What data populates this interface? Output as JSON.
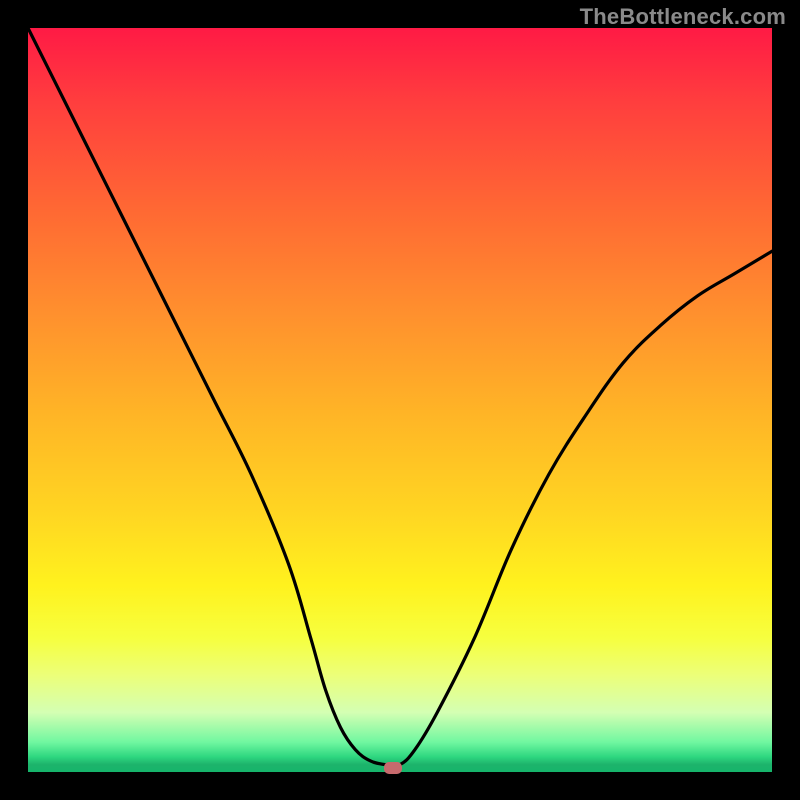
{
  "watermark": "TheBottleneck.com",
  "colors": {
    "curve_stroke": "#000000",
    "marker_fill": "#c76a6d",
    "frame": "#000000"
  },
  "chart_data": {
    "type": "line",
    "title": "",
    "xlabel": "",
    "ylabel": "",
    "xlim": [
      0,
      1
    ],
    "ylim": [
      0,
      1
    ],
    "grid": false,
    "legend": false,
    "series": [
      {
        "name": "bottleneck-curve",
        "x": [
          0.0,
          0.05,
          0.1,
          0.15,
          0.2,
          0.25,
          0.3,
          0.35,
          0.38,
          0.4,
          0.42,
          0.44,
          0.46,
          0.48,
          0.5,
          0.52,
          0.55,
          0.6,
          0.65,
          0.7,
          0.75,
          0.8,
          0.85,
          0.9,
          0.95,
          1.0
        ],
        "y": [
          1.0,
          0.9,
          0.8,
          0.7,
          0.6,
          0.5,
          0.4,
          0.28,
          0.18,
          0.11,
          0.06,
          0.03,
          0.015,
          0.01,
          0.01,
          0.03,
          0.08,
          0.18,
          0.3,
          0.4,
          0.48,
          0.55,
          0.6,
          0.64,
          0.67,
          0.7
        ]
      }
    ],
    "marker": {
      "x": 0.49,
      "y": 0.005
    },
    "background_gradient": {
      "type": "vertical",
      "stops": [
        {
          "pos": 0.0,
          "color": "#ff1a45"
        },
        {
          "pos": 0.25,
          "color": "#ff6a33"
        },
        {
          "pos": 0.55,
          "color": "#ffc225"
        },
        {
          "pos": 0.78,
          "color": "#fff21e"
        },
        {
          "pos": 0.92,
          "color": "#d4ffb3"
        },
        {
          "pos": 1.0,
          "color": "#16b56b"
        }
      ]
    }
  }
}
